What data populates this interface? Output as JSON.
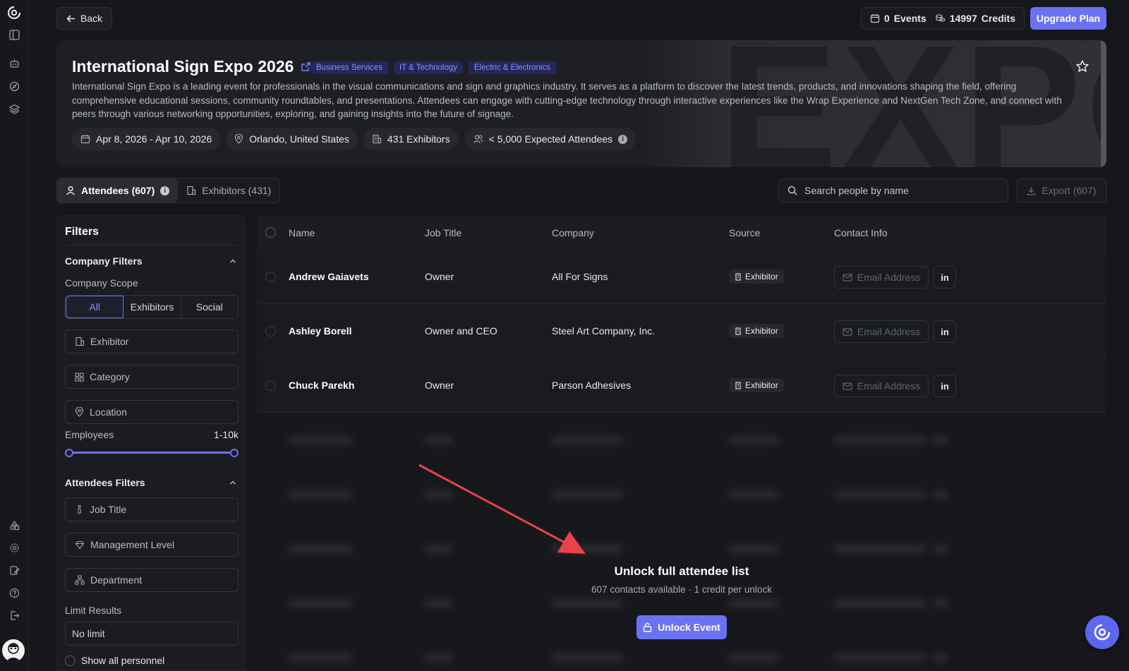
{
  "topbar": {
    "back_label": "Back",
    "events_count": "0",
    "events_label": "Events",
    "credits_count": "14997",
    "credits_label": "Credits",
    "upgrade_label": "Upgrade Plan"
  },
  "event": {
    "title": "International Sign Expo 2026",
    "tags": [
      "Business Services",
      "IT & Technology",
      "Electric & Electronics"
    ],
    "description": "International Sign Expo is a leading event for professionals in the visual communications and sign and graphics industry. It serves as a platform to discover the latest trends, products, and innovations shaping the field, offering comprehensive educational sessions, community roundtables, and presentations. Attendees can engage with cutting-edge technology through interactive experiences like the Wrap Experience and NextGen Tech Zone, and connect with peers through various networking opportunities, exploring, and gaining insights into the future of signage.",
    "dates": "Apr 8, 2026 - Apr 10, 2026",
    "location": "Orlando, United States",
    "exhibitors": "431 Exhibitors",
    "attendees": "< 5,000 Expected Attendees",
    "banner_text": "EXPO"
  },
  "tabs": {
    "attendees": "Attendees (607)",
    "exhibitors": "Exhibitors (431)"
  },
  "search": {
    "placeholder": "Search people by name"
  },
  "export_label": "Export (607)",
  "filters": {
    "title": "Filters",
    "company_section": "Company Filters",
    "scope_label": "Company Scope",
    "scope_options": [
      "All",
      "Exhibitors",
      "Social"
    ],
    "scope_selected": "All",
    "exhibitor": "Exhibitor",
    "category": "Category",
    "location": "Location",
    "employees_label": "Employees",
    "employees_value": "1-10k",
    "attendees_section": "Attendees Filters",
    "job_title": "Job Title",
    "management_level": "Management Level",
    "department": "Department",
    "limit_label": "Limit Results",
    "limit_value": "No limit",
    "show_all": "Show all personnel"
  },
  "table": {
    "headers": [
      "Name",
      "Job Title",
      "Company",
      "Source",
      "Contact Info"
    ],
    "rows": [
      {
        "name": "Andrew Gaiavets",
        "job": "Owner",
        "company": "All For Signs",
        "source": "Exhibitor",
        "email": "Email Address"
      },
      {
        "name": "Ashley Borell",
        "job": "Owner and CEO",
        "company": "Steel Art Company, Inc.",
        "source": "Exhibitor",
        "email": "Email Address"
      },
      {
        "name": "Chuck Parekh",
        "job": "Owner",
        "company": "Parson Adhesives",
        "source": "Exhibitor",
        "email": "Email Address"
      }
    ]
  },
  "unlock": {
    "title": "Unlock full attendee list",
    "subtitle": "607 contacts available · 1 credit per unlock",
    "button": "Unlock Event"
  },
  "colors": {
    "accent": "#6b72f2",
    "background": "#16171b",
    "tag_text": "#8d93ff",
    "arrow": "#e8424a"
  }
}
